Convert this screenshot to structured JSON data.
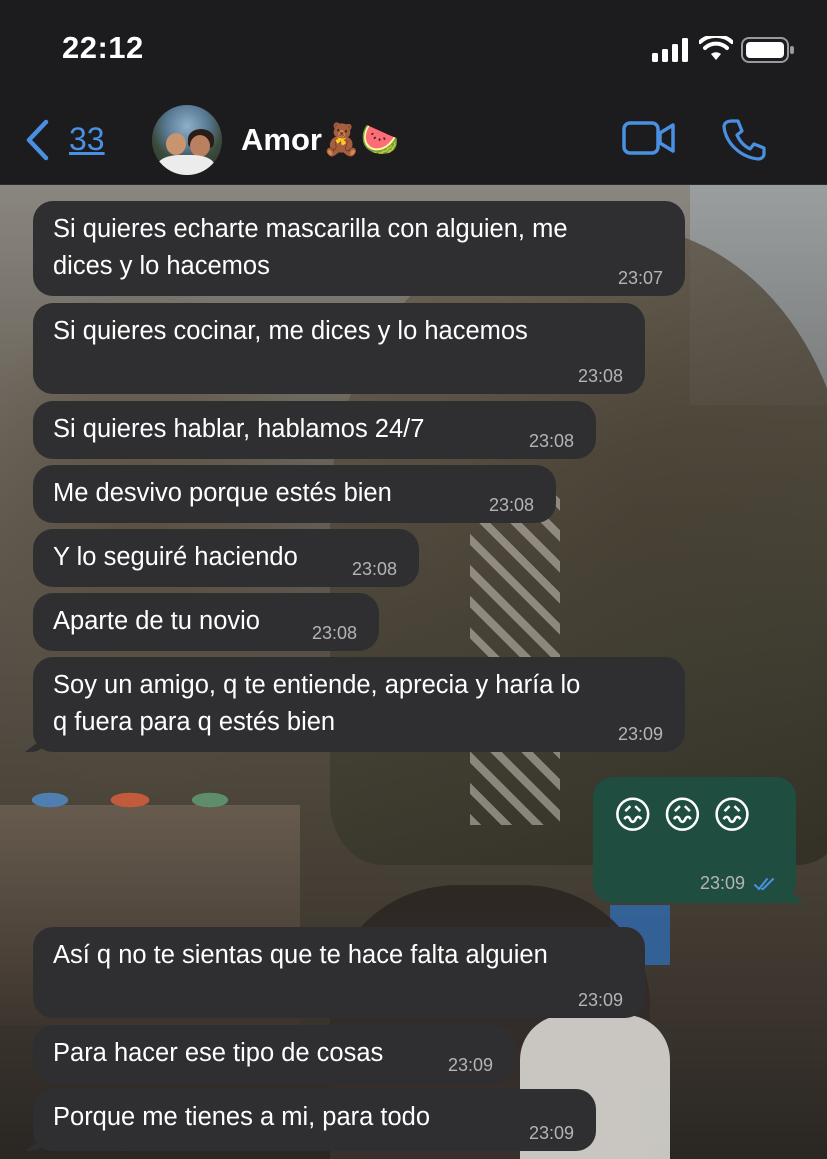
{
  "status_bar": {
    "time": "22:12"
  },
  "header": {
    "back_count": "33",
    "contact_name": "Amor🧸🍉",
    "accent_color": "#4a90e2"
  },
  "messages": [
    {
      "dir": "in",
      "text": "Si quieres echarte mascarilla con alguien, me\ndices y lo hacemos",
      "time": "23:07"
    },
    {
      "dir": "in",
      "text": "Si quieres cocinar, me dices y lo hacemos",
      "time": "23:08"
    },
    {
      "dir": "in",
      "text": "Si quieres hablar, hablamos 24/7",
      "time": "23:08"
    },
    {
      "dir": "in",
      "text": "Me desvivo porque estés bien",
      "time": "23:08"
    },
    {
      "dir": "in",
      "text": "Y lo seguiré haciendo",
      "time": "23:08"
    },
    {
      "dir": "in",
      "text": "Aparte de tu novio",
      "time": "23:08"
    },
    {
      "dir": "in",
      "text": "Soy un amigo, q te entiende, aprecia y haría lo\nq fuera para q estés bien",
      "time": "23:09"
    },
    {
      "dir": "out",
      "text": "😖😖😖",
      "time": "23:09",
      "status": "read"
    },
    {
      "dir": "in",
      "text": "Así q no te sientas que te hace falta alguien",
      "time": "23:09"
    },
    {
      "dir": "in",
      "text": "Para hacer ese tipo de cosas",
      "time": "23:09"
    },
    {
      "dir": "in",
      "text": "Porque me tienes a mi, para todo",
      "time": "23:09"
    }
  ]
}
